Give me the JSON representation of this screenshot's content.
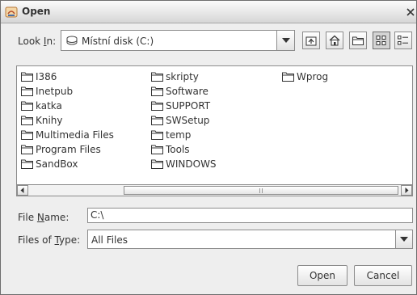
{
  "window": {
    "title": "Open"
  },
  "lookin": {
    "label_pre": "Look ",
    "label_mnemonic": "I",
    "label_post": "n:",
    "value": "Místní disk (C:)"
  },
  "toolbar": {
    "icons": [
      "up-one-level-icon",
      "home-icon",
      "new-folder-icon",
      "list-view-icon",
      "details-view-icon"
    ],
    "active": "list-view-icon"
  },
  "files": {
    "columns": [
      [
        "I386",
        "Inetpub",
        "katka",
        "Knihy",
        "Multimedia Files",
        "Program Files",
        "SandBox"
      ],
      [
        "skripty",
        "Software",
        "SUPPORT",
        "SWSetup",
        "temp",
        "Tools",
        "WINDOWS"
      ],
      [
        "Wprog"
      ]
    ]
  },
  "filename": {
    "label_pre": "File ",
    "label_mnemonic": "N",
    "label_post": "ame:",
    "value": "C:\\"
  },
  "filetype": {
    "label_pre": "Files of ",
    "label_mnemonic": "T",
    "label_post": "ype:",
    "value": "All Files"
  },
  "buttons": {
    "open": "Open",
    "cancel": "Cancel"
  },
  "colors": {
    "titlebar": "#d6d6d6",
    "background": "#eeeeee",
    "border": "#8c8c8c"
  }
}
